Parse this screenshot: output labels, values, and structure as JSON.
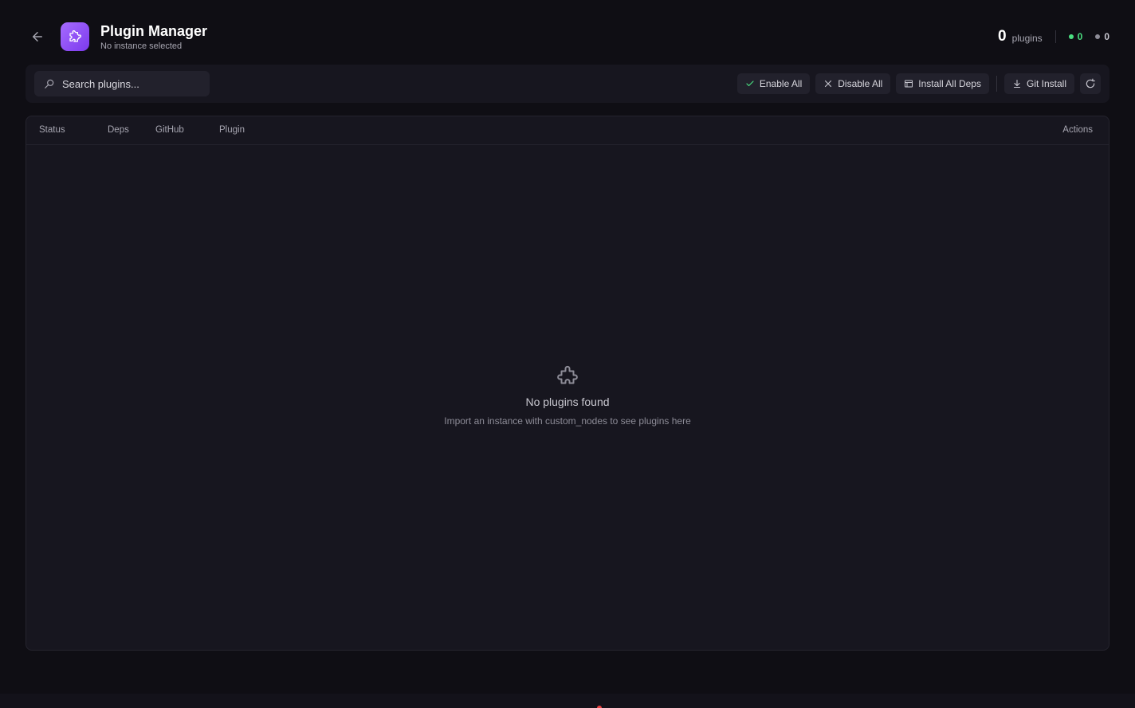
{
  "header": {
    "title": "Plugin Manager",
    "subtitle": "No instance selected",
    "plugin_count": "0",
    "plugin_count_label": "plugins",
    "enabled_count": "0",
    "disabled_count": "0"
  },
  "toolbar": {
    "search_placeholder": "Search plugins...",
    "enable_all": "Enable All",
    "disable_all": "Disable All",
    "install_all_deps": "Install All Deps",
    "git_install": "Git Install"
  },
  "table": {
    "columns": {
      "status": "Status",
      "deps": "Deps",
      "github": "GitHub",
      "plugin": "Plugin",
      "actions": "Actions"
    },
    "empty_title": "No plugins found",
    "empty_description": "Import an instance with custom_nodes to see plugins here"
  },
  "colors": {
    "accent": "#8b5cf6",
    "enabled": "#4ade80",
    "disabled": "#8d8c97",
    "background": "#0f0e14"
  },
  "icons": {
    "back": "arrow-left-icon",
    "app": "puzzle-icon",
    "search": "search-icon",
    "enable": "check-icon",
    "disable": "x-icon",
    "deps": "package-icon",
    "git": "download-icon",
    "refresh": "refresh-icon",
    "empty": "puzzle-icon"
  }
}
